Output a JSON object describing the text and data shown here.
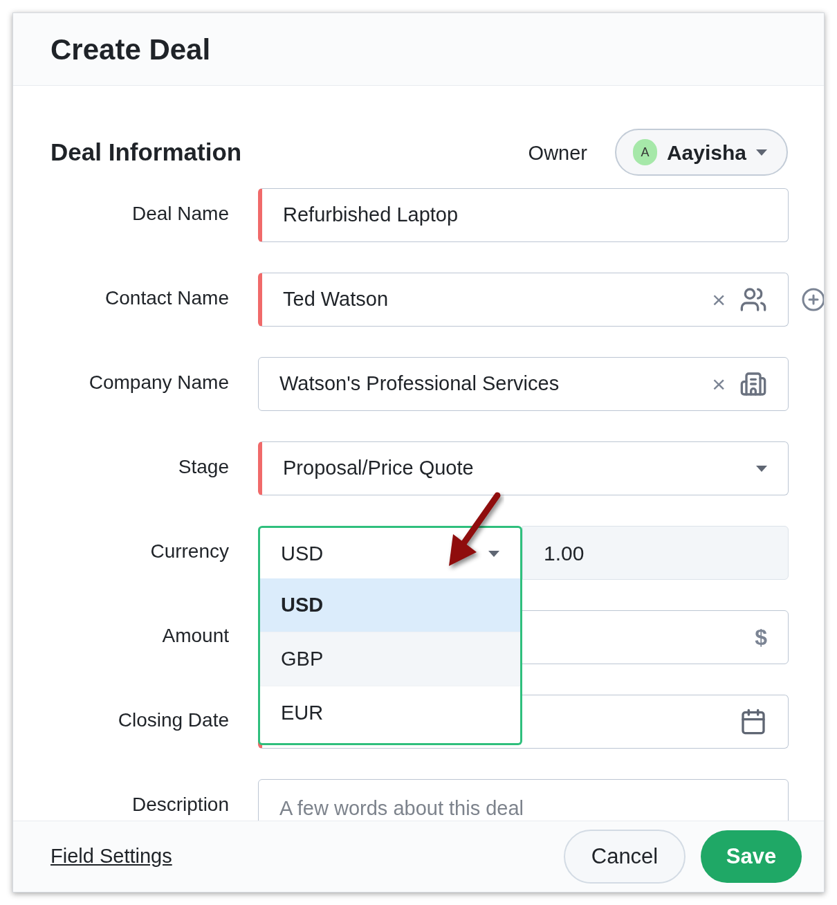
{
  "dialog": {
    "title": "Create Deal"
  },
  "section": {
    "title": "Deal Information",
    "owner_label": "Owner",
    "owner": {
      "initial": "A",
      "name": "Aayisha"
    }
  },
  "fields": [
    {
      "label": "Deal Name",
      "kind": "text",
      "value": "Refurbished Laptop",
      "required": true
    },
    {
      "label": "Contact Name",
      "kind": "contact",
      "value": "Ted Watson",
      "required": true,
      "clear": "×"
    },
    {
      "label": "Company Name",
      "kind": "company",
      "value": "Watson's Professional Services",
      "required": false,
      "clear": "×"
    },
    {
      "label": "Stage",
      "kind": "select",
      "value": "Proposal/Price Quote",
      "required": true
    },
    {
      "label": "Currency",
      "kind": "currency",
      "value": "USD",
      "rate": "1.00",
      "required": false,
      "expanded": true,
      "options": [
        {
          "label": "USD",
          "selected": true,
          "highlighted": false
        },
        {
          "label": "GBP",
          "selected": false,
          "highlighted": true
        },
        {
          "label": "EUR",
          "selected": false,
          "highlighted": false
        }
      ]
    },
    {
      "label": "Amount",
      "kind": "amount",
      "symbol": "$",
      "required": false
    },
    {
      "label": "Closing Date",
      "kind": "date",
      "required": true
    },
    {
      "label": "Description",
      "kind": "textarea",
      "placeholder": "A few words about this deal",
      "required": false
    }
  ],
  "footer": {
    "link": "Field Settings",
    "buttons": [
      {
        "label": "Cancel",
        "kind": "secondary"
      },
      {
        "label": "Save",
        "kind": "primary"
      }
    ]
  }
}
